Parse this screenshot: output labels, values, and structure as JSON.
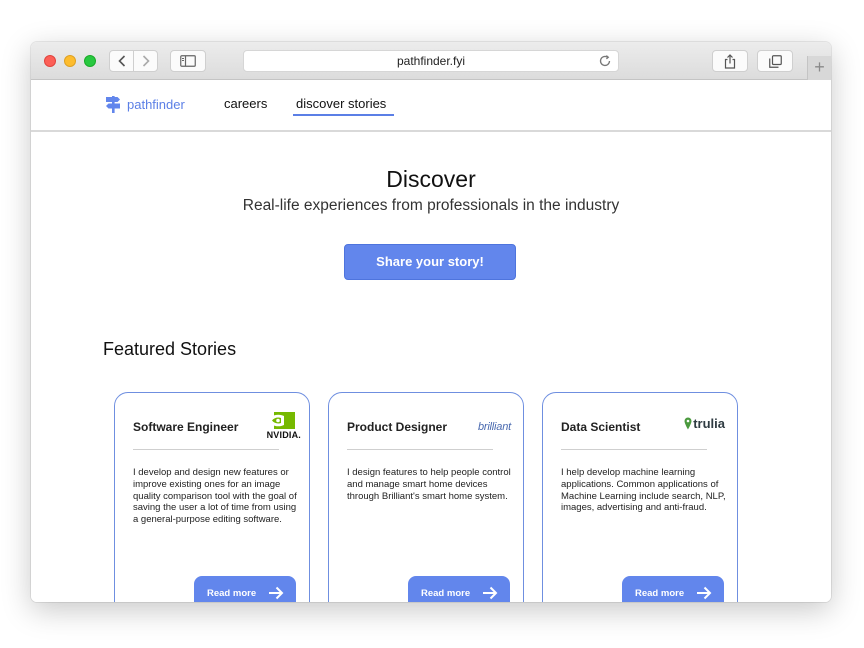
{
  "browser": {
    "url": "pathfinder.fyi"
  },
  "nav": {
    "brand": "pathfinder",
    "links": [
      "careers",
      "discover stories"
    ],
    "active": "discover stories"
  },
  "hero": {
    "title": "Discover",
    "subtitle": "Real-life experiences from professionals in the industry",
    "cta": "Share your story!"
  },
  "featured": {
    "heading": "Featured Stories",
    "cards": [
      {
        "title": "Software Engineer",
        "company": "NVIDIA.",
        "description": "I develop and design new features or improve existing ones for an image quality comparison tool with the goal of saving the user a lot of time from using a general-purpose editing software.",
        "button": "Read more"
      },
      {
        "title": "Product Designer",
        "company": "brilliant",
        "description": "I design features to help people control and manage smart home devices through Brilliant's smart home system.",
        "button": "Read more"
      },
      {
        "title": "Data Scientist",
        "company": "trulia",
        "description": "I help develop machine learning applications. Common applications of Machine Learning include search, NLP, images, advertising and anti-fraud.",
        "button": "Read more"
      }
    ]
  },
  "colors": {
    "accent": "#6286ec",
    "card_border": "#6f8fe0",
    "nvidia_green": "#76b900",
    "trulia_green": "#4b9a3e"
  }
}
